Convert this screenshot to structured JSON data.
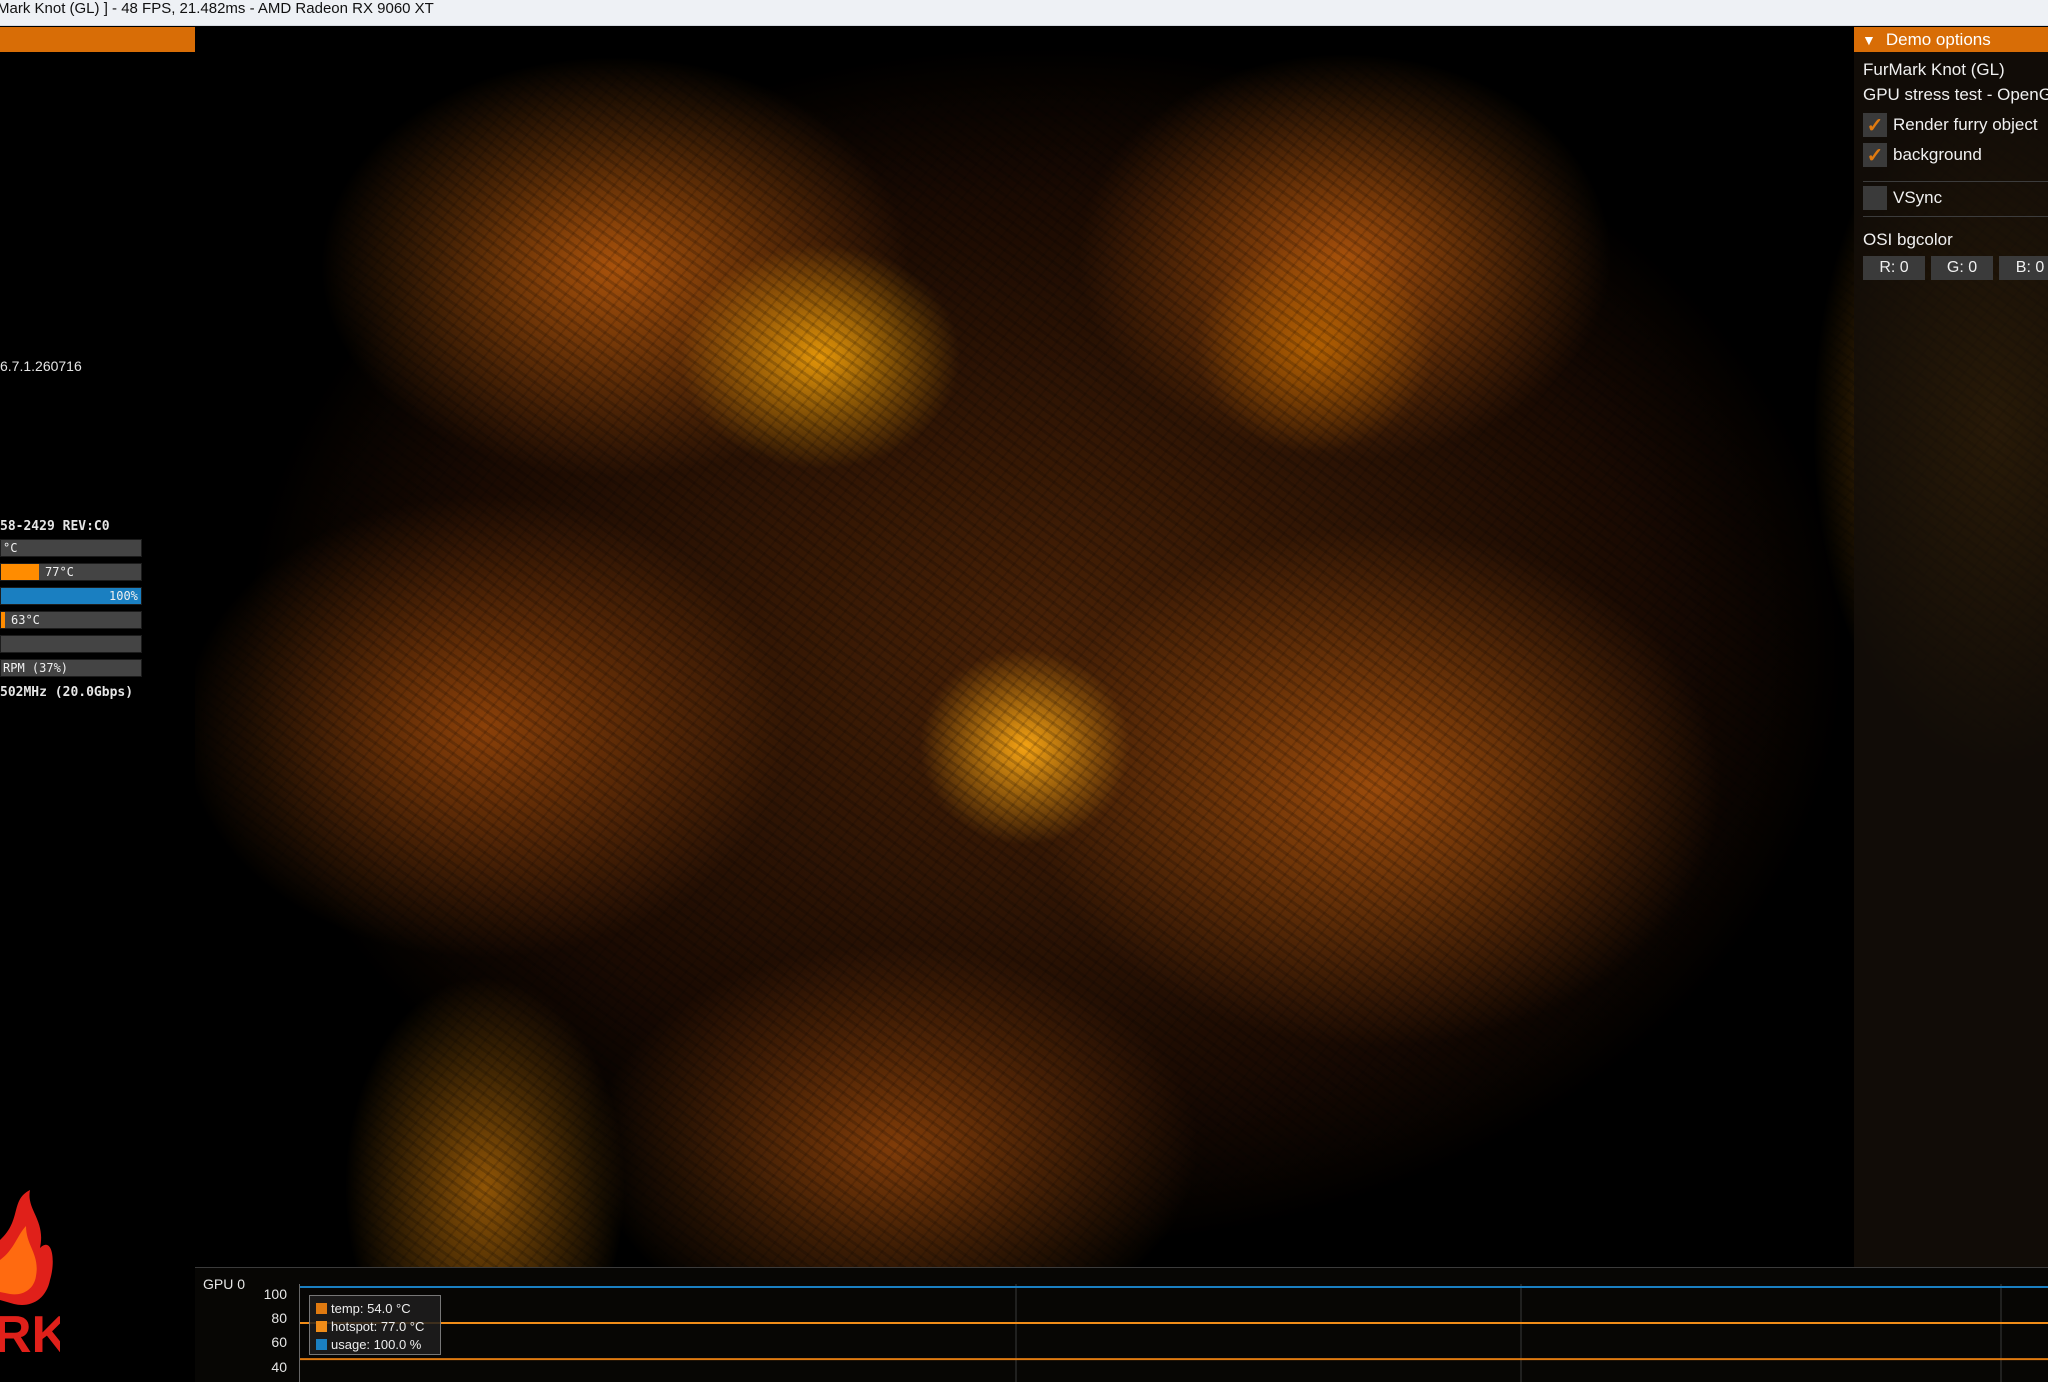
{
  "window": {
    "title": "Mark Knot (GL) ] - 48 FPS, 21.482ms - AMD Radeon RX 9060 XT"
  },
  "osd": {
    "version": "6.7.1.260716",
    "gpu_id": "58-2429 REV:C0",
    "bars": [
      {
        "label": "°C",
        "fill_pct": 0,
        "color": "#ff8c00"
      },
      {
        "label": "77°C",
        "fill_pct": 27,
        "color": "#ff8c00"
      },
      {
        "label": "100%",
        "fill_pct": 100,
        "color": "#1a7fc1"
      },
      {
        "label": "63°C",
        "fill_pct": 3,
        "color": "#ff8c00"
      },
      {
        "label": "",
        "fill_pct": 0,
        "color": "#ff8c00"
      },
      {
        "label": "RPM (37%)",
        "fill_pct": 0,
        "color": "#ff8c00"
      }
    ],
    "memory": "502MHz (20.0Gbps)"
  },
  "demo_panel": {
    "header": "Demo options",
    "app_name": "FurMark Knot (GL)",
    "subtitle": "GPU stress test - OpenGL",
    "checkboxes": [
      {
        "label": "Render furry object",
        "checked": true,
        "check_glyph": "✓"
      },
      {
        "label": "background",
        "checked": true,
        "check_glyph": "✓"
      },
      {
        "label": "VSync",
        "checked": false,
        "check_glyph": ""
      }
    ],
    "osi_label": "OSI bgcolor",
    "rgb": [
      {
        "label": "R: 0"
      },
      {
        "label": "G: 0"
      },
      {
        "label": "B: 0"
      }
    ]
  },
  "graph": {
    "title": "GPU 0",
    "yticks": [
      "100",
      "80",
      "60",
      "40"
    ],
    "legend": [
      {
        "label": "temp: 54.0 °C",
        "color": "#e07a10"
      },
      {
        "label": "hotspot: 77.0 °C",
        "color": "#f08c18"
      },
      {
        "label": "usage: 100.0 %",
        "color": "#1a7fc1"
      }
    ],
    "series_levels": {
      "usage": 100,
      "hotspot": 77,
      "temp": 54
    },
    "y_range": [
      40,
      100
    ]
  }
}
